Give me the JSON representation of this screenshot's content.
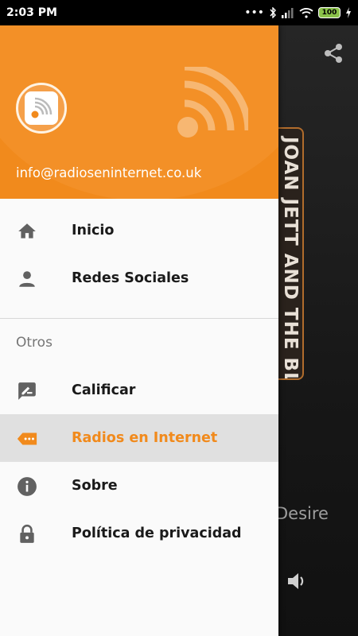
{
  "status_bar": {
    "time": "2:03 PM",
    "dots": "•••",
    "battery": "100"
  },
  "background_app": {
    "album_text": "JOAN JETT AND THE BLACKHEARTS",
    "track_fragment": "Desire",
    "share_icon": "share-icon",
    "volume_icon": "volume-icon"
  },
  "drawer": {
    "email": "info@radioseninternet.co.uk",
    "accent_color": "#f18a1c",
    "items": [
      {
        "label": "Inicio",
        "icon": "home-icon"
      },
      {
        "label": "Redes Sociales",
        "icon": "person-icon"
      }
    ],
    "section_label": "Otros",
    "other_items": [
      {
        "label": "Calificar",
        "icon": "rate-icon"
      },
      {
        "label": "Radios en Internet",
        "icon": "label-icon",
        "active": true
      },
      {
        "label": "Sobre",
        "icon": "info-icon"
      },
      {
        "label": "Política de privacidad",
        "icon": "lock-icon"
      }
    ]
  }
}
